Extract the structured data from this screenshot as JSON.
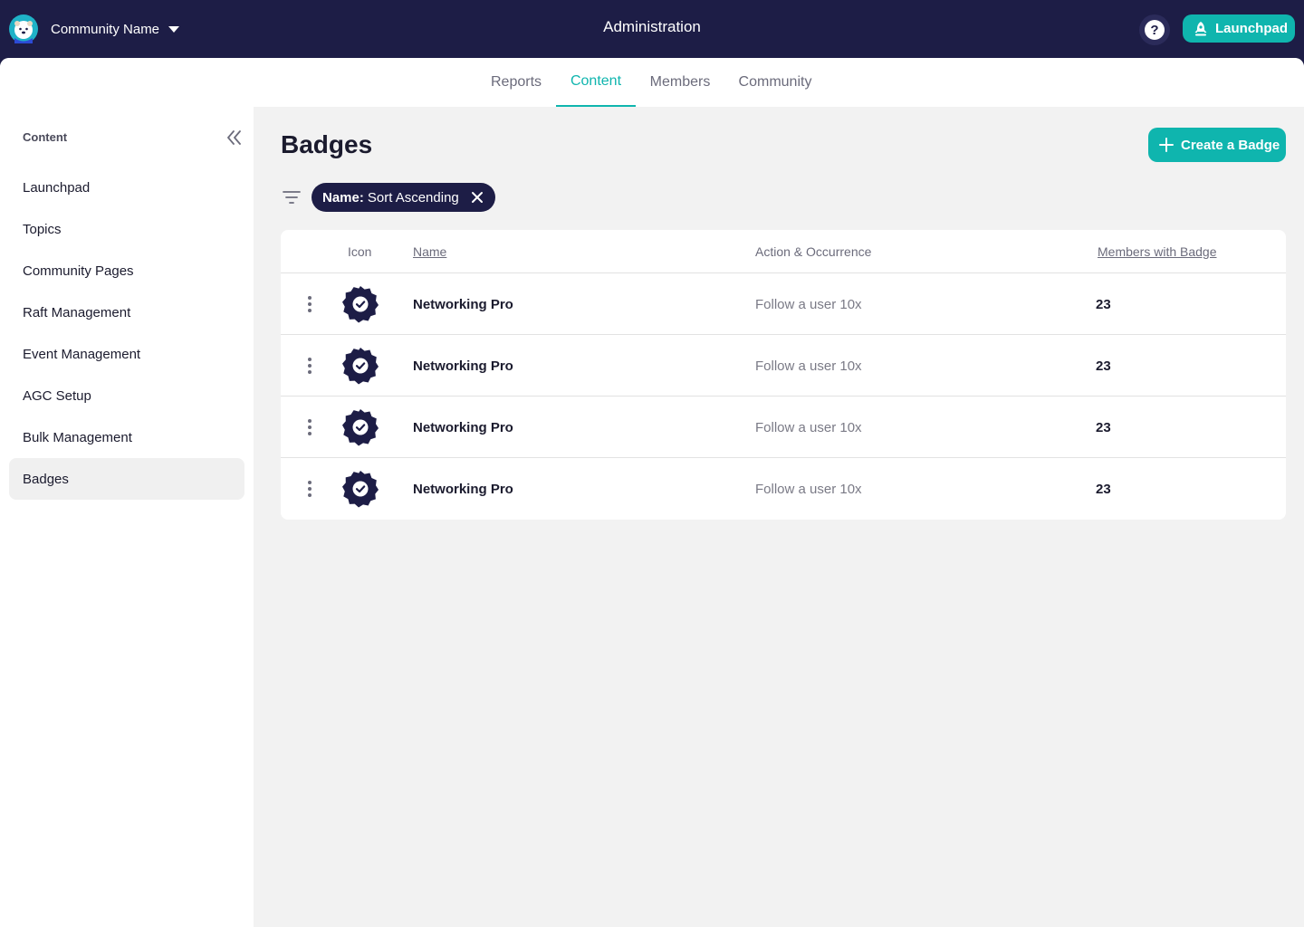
{
  "topbar": {
    "community_name": "Community Name",
    "title": "Administration",
    "help_label": "?",
    "launchpad_label": "Launchpad",
    "bg_color": "#1d1d46",
    "accent_color": "#0fb5ae"
  },
  "tabs": [
    {
      "label": "Reports",
      "active": false
    },
    {
      "label": "Content",
      "active": true
    },
    {
      "label": "Members",
      "active": false
    },
    {
      "label": "Community",
      "active": false
    }
  ],
  "sidebar": {
    "title": "Content",
    "items": [
      {
        "label": "Launchpad"
      },
      {
        "label": "Topics"
      },
      {
        "label": "Community Pages"
      },
      {
        "label": "Raft Management"
      },
      {
        "label": "Event Management"
      },
      {
        "label": "AGC Setup"
      },
      {
        "label": "Bulk Management"
      },
      {
        "label": "Badges",
        "active": true
      }
    ]
  },
  "main": {
    "title": "Badges",
    "create_label": "Create a Badge",
    "filter_chip": {
      "key": "Name:",
      "value": "Sort Ascending"
    }
  },
  "table": {
    "headers": {
      "icon": "Icon",
      "name": "Name",
      "action": "Action & Occurrence",
      "members": "Members with Badge"
    },
    "rows": [
      {
        "name": "Networking Pro",
        "action": "Follow a user 10x",
        "members": "23"
      },
      {
        "name": "Networking Pro",
        "action": "Follow a user 10x",
        "members": "23"
      },
      {
        "name": "Networking Pro",
        "action": "Follow a user 10x",
        "members": "23"
      },
      {
        "name": "Networking Pro",
        "action": "Follow a user 10x",
        "members": "23"
      }
    ]
  }
}
